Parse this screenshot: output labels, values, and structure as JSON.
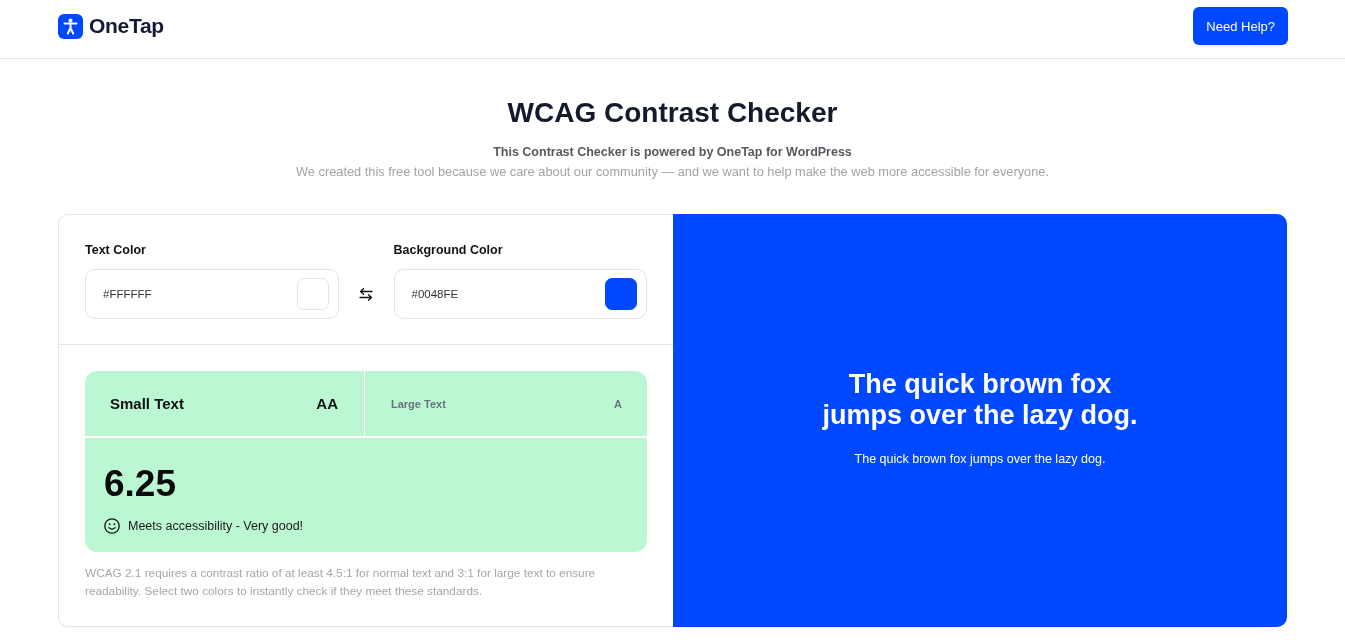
{
  "header": {
    "brand": "OneTap",
    "help_button": "Need Help?"
  },
  "intro": {
    "title": "WCAG Contrast Checker",
    "subtitle": "This Contrast Checker is powered by OneTap for WordPress",
    "description": "We created this free tool because we care about our community — and we want to help make the web more accessible for everyone."
  },
  "color_fields": [
    {
      "label": "Text Color",
      "value": "#FFFFFF",
      "color": "#ffffff"
    },
    {
      "label": "Background Color",
      "value": "#0048FE",
      "color": "#0048fe"
    }
  ],
  "result": {
    "passed": true,
    "tabs": [
      {
        "label": "Small Text",
        "grade": "AA",
        "selected": true
      },
      {
        "label": "Large Text",
        "grade": "A",
        "selected": false
      }
    ],
    "ratio": "6.25",
    "verdict": "Meets accessibility - Very good!"
  },
  "note": "WCAG 2.1 requires a contrast ratio of at least 4.5:1 for normal text and 3:1 for large text to ensure readability. Select two colors to instantly check if they meet these standards.",
  "preview": {
    "heading": "The quick brown fox jumps over the lazy dog.",
    "body": "The quick brown fox jumps over the lazy dog."
  }
}
